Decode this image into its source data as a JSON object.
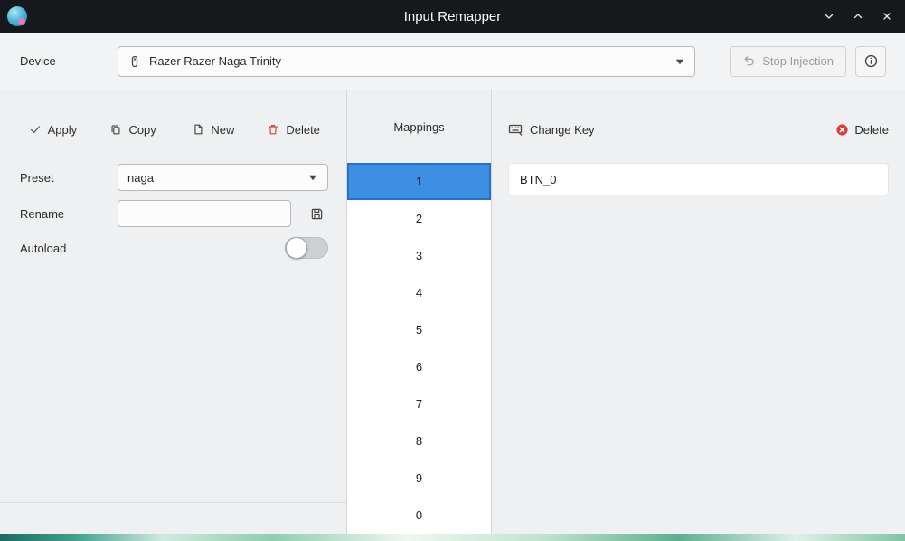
{
  "window": {
    "title": "Input Remapper"
  },
  "device_bar": {
    "label": "Device",
    "device_value": "Razer Razer Naga Trinity",
    "stop_injection_label": "Stop Injection"
  },
  "toolbar": {
    "apply": "Apply",
    "copy": "Copy",
    "new": "New",
    "delete": "Delete"
  },
  "preset": {
    "label": "Preset",
    "value": "naga"
  },
  "rename": {
    "label": "Rename",
    "value": ""
  },
  "autoload": {
    "label": "Autoload",
    "state": "off"
  },
  "mappings": {
    "header": "Mappings",
    "items": [
      "1",
      "2",
      "3",
      "4",
      "5",
      "6",
      "7",
      "8",
      "9",
      "0"
    ],
    "selected_index": 0
  },
  "editor": {
    "change_key_label": "Change Key",
    "delete_label": "Delete",
    "mapping_value": "BTN_0"
  },
  "icons": {
    "titlebar": [
      "app-logo",
      "minimize-icon",
      "maximize-icon",
      "close-icon"
    ],
    "colors": {
      "selection": "#3d8fe4",
      "titlebar_bg": "#16191c",
      "delete_red": "#d4423e"
    }
  }
}
